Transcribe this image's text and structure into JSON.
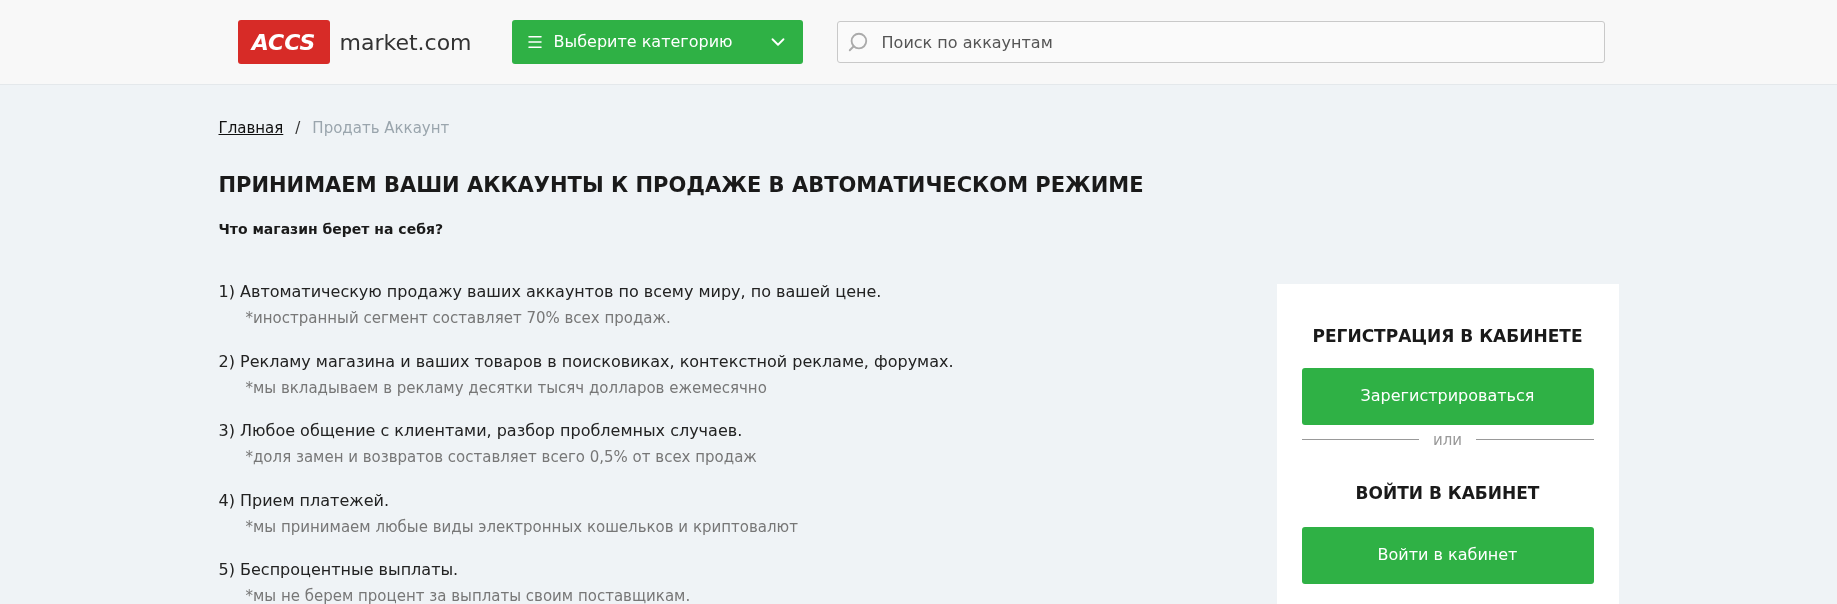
{
  "header": {
    "logo_badge": "ACCS",
    "logo_text": "market.com",
    "category_button": "Выберите категорию",
    "search": {
      "placeholder": "Поиск по аккаунтам"
    }
  },
  "breadcrumb": [
    {
      "label": "Главная",
      "kind": "link"
    },
    {
      "label": "Продать Аккаунт",
      "kind": "current"
    }
  ],
  "breadcrumb_separator": "/",
  "title": "ПРИНИМАЕМ ВАШИ АККАУНТЫ К ПРОДАЖЕ В АВТОМАТИЧЕСКОМ РЕЖИМЕ",
  "subtitle": "Что магазин берет на себя?",
  "items": [
    {
      "text": "1) Автоматическую продажу ваших аккаунтов по всему миру, по вашей цене.",
      "note": "*иностранный сегмент составляет 70% всех продаж."
    },
    {
      "text": "2) Рекламу магазина и ваших товаров в поисковиках, контекстной рекламе, форумах.",
      "note": "*мы вкладываем в рекламу десятки тысяч долларов ежемесячно"
    },
    {
      "text": "3) Любое общение с клиентами, разбор проблемных случаев.",
      "note": "*доля замен и возвратов составляет всего 0,5% от всех продаж"
    },
    {
      "text": "4) Прием платежей.",
      "note": "*мы принимаем любые виды электронных кошельков и криптовалют"
    },
    {
      "text": "5) Беспроцентные выплаты.",
      "note": "*мы не берем процент за выплаты своим поставщикам."
    }
  ],
  "auth_card": {
    "register_heading": "РЕГИСТРАЦИЯ В КАБИНЕТЕ",
    "register_button": "Зарегистрироваться",
    "divider": "или",
    "login_heading": "ВОЙТИ В КАБИНЕТ",
    "login_button": "Войти в кабинет"
  }
}
